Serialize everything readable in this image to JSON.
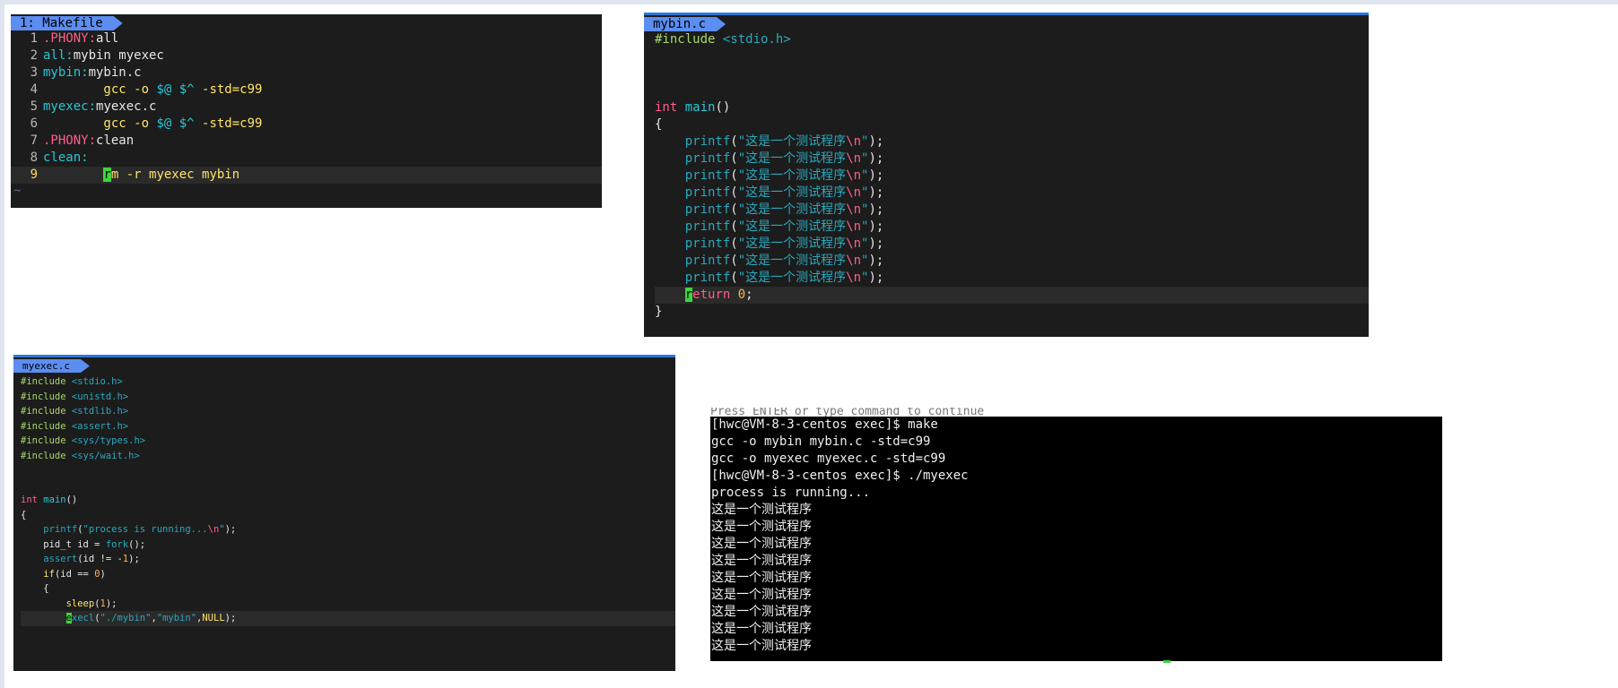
{
  "makefile": {
    "tab_label": "1: Makefile",
    "tilde": "~",
    "lines": [
      {
        "n": "1",
        "parts": [
          {
            "t": ".PHONY:",
            "c": "k-red"
          },
          {
            "t": "all",
            "c": "k-white"
          }
        ]
      },
      {
        "n": "2",
        "parts": [
          {
            "t": "all:",
            "c": "k-cyan"
          },
          {
            "t": "mybin myexec",
            "c": "k-white"
          }
        ]
      },
      {
        "n": "3",
        "parts": [
          {
            "t": "mybin:",
            "c": "k-cyan"
          },
          {
            "t": "mybin.c",
            "c": "k-white"
          }
        ]
      },
      {
        "n": "4",
        "parts": [
          {
            "t": "        gcc -o ",
            "c": "k-yellow"
          },
          {
            "t": "$@ $^",
            "c": "k-cyan"
          },
          {
            "t": " -std=c99",
            "c": "k-yellow"
          }
        ]
      },
      {
        "n": "5",
        "parts": [
          {
            "t": "myexec:",
            "c": "k-cyan"
          },
          {
            "t": "myexec.c",
            "c": "k-white"
          }
        ]
      },
      {
        "n": "6",
        "parts": [
          {
            "t": "        gcc -o ",
            "c": "k-yellow"
          },
          {
            "t": "$@ $^",
            "c": "k-cyan"
          },
          {
            "t": " -std=c99",
            "c": "k-yellow"
          }
        ]
      },
      {
        "n": "7",
        "parts": [
          {
            "t": ".PHONY:",
            "c": "k-red"
          },
          {
            "t": "clean",
            "c": "k-white"
          }
        ]
      },
      {
        "n": "8",
        "parts": [
          {
            "t": "clean:",
            "c": "k-cyan"
          }
        ]
      },
      {
        "n": "9",
        "cursorline": true,
        "parts": [
          {
            "t": "        ",
            "c": "k-white"
          },
          {
            "t": "r",
            "c": "cursor"
          },
          {
            "t": "m -r myexec mybin",
            "c": "k-yellow"
          }
        ]
      }
    ]
  },
  "mybin": {
    "tab_label": "mybin.c",
    "lines": [
      {
        "parts": [
          {
            "t": "#include ",
            "c": "k-green"
          },
          {
            "t": "<stdio.h>",
            "c": "k-teal"
          }
        ]
      },
      {
        "parts": []
      },
      {
        "parts": []
      },
      {
        "parts": []
      },
      {
        "parts": [
          {
            "t": "int ",
            "c": "k-red"
          },
          {
            "t": "main",
            "c": "k-cyan"
          },
          {
            "t": "()",
            "c": "k-white"
          }
        ]
      },
      {
        "parts": [
          {
            "t": "{",
            "c": "k-white"
          }
        ]
      },
      {
        "parts": [
          {
            "t": "    printf",
            "c": "k-teal"
          },
          {
            "t": "(",
            "c": "k-white"
          },
          {
            "t": "\"这是一个测试程序",
            "c": "k-teal"
          },
          {
            "t": "\\n",
            "c": "k-esc"
          },
          {
            "t": "\"",
            "c": "k-teal"
          },
          {
            "t": ");",
            "c": "k-white"
          }
        ]
      },
      {
        "parts": [
          {
            "t": "    printf",
            "c": "k-teal"
          },
          {
            "t": "(",
            "c": "k-white"
          },
          {
            "t": "\"这是一个测试程序",
            "c": "k-teal"
          },
          {
            "t": "\\n",
            "c": "k-esc"
          },
          {
            "t": "\"",
            "c": "k-teal"
          },
          {
            "t": ");",
            "c": "k-white"
          }
        ]
      },
      {
        "parts": [
          {
            "t": "    printf",
            "c": "k-teal"
          },
          {
            "t": "(",
            "c": "k-white"
          },
          {
            "t": "\"这是一个测试程序",
            "c": "k-teal"
          },
          {
            "t": "\\n",
            "c": "k-esc"
          },
          {
            "t": "\"",
            "c": "k-teal"
          },
          {
            "t": ");",
            "c": "k-white"
          }
        ]
      },
      {
        "parts": [
          {
            "t": "    printf",
            "c": "k-teal"
          },
          {
            "t": "(",
            "c": "k-white"
          },
          {
            "t": "\"这是一个测试程序",
            "c": "k-teal"
          },
          {
            "t": "\\n",
            "c": "k-esc"
          },
          {
            "t": "\"",
            "c": "k-teal"
          },
          {
            "t": ");",
            "c": "k-white"
          }
        ]
      },
      {
        "parts": [
          {
            "t": "    printf",
            "c": "k-teal"
          },
          {
            "t": "(",
            "c": "k-white"
          },
          {
            "t": "\"这是一个测试程序",
            "c": "k-teal"
          },
          {
            "t": "\\n",
            "c": "k-esc"
          },
          {
            "t": "\"",
            "c": "k-teal"
          },
          {
            "t": ");",
            "c": "k-white"
          }
        ]
      },
      {
        "parts": [
          {
            "t": "    printf",
            "c": "k-teal"
          },
          {
            "t": "(",
            "c": "k-white"
          },
          {
            "t": "\"这是一个测试程序",
            "c": "k-teal"
          },
          {
            "t": "\\n",
            "c": "k-esc"
          },
          {
            "t": "\"",
            "c": "k-teal"
          },
          {
            "t": ");",
            "c": "k-white"
          }
        ]
      },
      {
        "parts": [
          {
            "t": "    printf",
            "c": "k-teal"
          },
          {
            "t": "(",
            "c": "k-white"
          },
          {
            "t": "\"这是一个测试程序",
            "c": "k-teal"
          },
          {
            "t": "\\n",
            "c": "k-esc"
          },
          {
            "t": "\"",
            "c": "k-teal"
          },
          {
            "t": ");",
            "c": "k-white"
          }
        ]
      },
      {
        "parts": [
          {
            "t": "    printf",
            "c": "k-teal"
          },
          {
            "t": "(",
            "c": "k-white"
          },
          {
            "t": "\"这是一个测试程序",
            "c": "k-teal"
          },
          {
            "t": "\\n",
            "c": "k-esc"
          },
          {
            "t": "\"",
            "c": "k-teal"
          },
          {
            "t": ");",
            "c": "k-white"
          }
        ]
      },
      {
        "parts": [
          {
            "t": "    printf",
            "c": "k-teal"
          },
          {
            "t": "(",
            "c": "k-white"
          },
          {
            "t": "\"这是一个测试程序",
            "c": "k-teal"
          },
          {
            "t": "\\n",
            "c": "k-esc"
          },
          {
            "t": "\"",
            "c": "k-teal"
          },
          {
            "t": ");",
            "c": "k-white"
          }
        ]
      },
      {
        "cursorline": true,
        "parts": [
          {
            "t": "    ",
            "c": "k-white"
          },
          {
            "t": "r",
            "c": "cursor"
          },
          {
            "t": "eturn ",
            "c": "k-red"
          },
          {
            "t": "0",
            "c": "k-num"
          },
          {
            "t": ";",
            "c": "k-white"
          }
        ]
      },
      {
        "parts": [
          {
            "t": "}",
            "c": "k-white"
          }
        ]
      }
    ]
  },
  "myexec": {
    "tab_label": "myexec.c",
    "lines": [
      {
        "parts": [
          {
            "t": "#include ",
            "c": "k-green"
          },
          {
            "t": "<stdio.h>",
            "c": "k-teal"
          }
        ]
      },
      {
        "parts": [
          {
            "t": "#include ",
            "c": "k-green"
          },
          {
            "t": "<unistd.h>",
            "c": "k-teal"
          }
        ]
      },
      {
        "parts": [
          {
            "t": "#include ",
            "c": "k-green"
          },
          {
            "t": "<stdlib.h>",
            "c": "k-teal"
          }
        ]
      },
      {
        "parts": [
          {
            "t": "#include ",
            "c": "k-green"
          },
          {
            "t": "<assert.h>",
            "c": "k-teal"
          }
        ]
      },
      {
        "parts": [
          {
            "t": "#include ",
            "c": "k-green"
          },
          {
            "t": "<sys/types.h>",
            "c": "k-teal"
          }
        ]
      },
      {
        "parts": [
          {
            "t": "#include ",
            "c": "k-green"
          },
          {
            "t": "<sys/wait.h>",
            "c": "k-teal"
          }
        ]
      },
      {
        "parts": []
      },
      {
        "parts": []
      },
      {
        "parts": [
          {
            "t": "int ",
            "c": "k-red"
          },
          {
            "t": "main",
            "c": "k-cyan"
          },
          {
            "t": "()",
            "c": "k-white"
          }
        ]
      },
      {
        "parts": [
          {
            "t": "{",
            "c": "k-white"
          }
        ]
      },
      {
        "parts": [
          {
            "t": "    printf",
            "c": "k-teal"
          },
          {
            "t": "(",
            "c": "k-white"
          },
          {
            "t": "\"process is running...",
            "c": "k-teal"
          },
          {
            "t": "\\n",
            "c": "k-esc"
          },
          {
            "t": "\"",
            "c": "k-teal"
          },
          {
            "t": ");",
            "c": "k-white"
          }
        ]
      },
      {
        "parts": [
          {
            "t": "    pid_t id = ",
            "c": "k-white"
          },
          {
            "t": "fork",
            "c": "k-teal"
          },
          {
            "t": "();",
            "c": "k-white"
          }
        ]
      },
      {
        "parts": [
          {
            "t": "    assert",
            "c": "k-teal"
          },
          {
            "t": "(id != -",
            "c": "k-white"
          },
          {
            "t": "1",
            "c": "k-num"
          },
          {
            "t": ");",
            "c": "k-white"
          }
        ]
      },
      {
        "parts": [
          {
            "t": "    if",
            "c": "k-yellow"
          },
          {
            "t": "(id == ",
            "c": "k-white"
          },
          {
            "t": "0",
            "c": "k-num"
          },
          {
            "t": ")",
            "c": "k-white"
          }
        ]
      },
      {
        "parts": [
          {
            "t": "    {",
            "c": "k-white"
          }
        ]
      },
      {
        "parts": [
          {
            "t": "        sleep",
            "c": "k-yellow"
          },
          {
            "t": "(",
            "c": "k-white"
          },
          {
            "t": "1",
            "c": "k-num"
          },
          {
            "t": ");",
            "c": "k-white"
          }
        ]
      },
      {
        "cursorline": true,
        "parts": [
          {
            "t": "        ",
            "c": "k-white"
          },
          {
            "t": "e",
            "c": "cursor"
          },
          {
            "t": "xecl",
            "c": "k-teal"
          },
          {
            "t": "(",
            "c": "k-white"
          },
          {
            "t": "\"./mybin\"",
            "c": "k-teal"
          },
          {
            "t": ",",
            "c": "k-white"
          },
          {
            "t": "\"mybin\"",
            "c": "k-teal"
          },
          {
            "t": ",",
            "c": "k-white"
          },
          {
            "t": "NULL",
            "c": "k-yellow"
          },
          {
            "t": ");",
            "c": "k-white"
          }
        ]
      }
    ]
  },
  "terminal": {
    "top_partial": "Press ENTER or type command to continue",
    "lines": [
      "[hwc@VM-8-3-centos exec]$ make",
      "gcc -o mybin mybin.c -std=c99",
      "gcc -o myexec myexec.c -std=c99",
      "[hwc@VM-8-3-centos exec]$ ./myexec",
      "process is running...",
      "这是一个测试程序",
      "这是一个测试程序",
      "这是一个测试程序",
      "这是一个测试程序",
      "这是一个测试程序",
      "这是一个测试程序",
      "这是一个测试程序",
      "这是一个测试程序",
      "这是一个测试程序"
    ]
  }
}
